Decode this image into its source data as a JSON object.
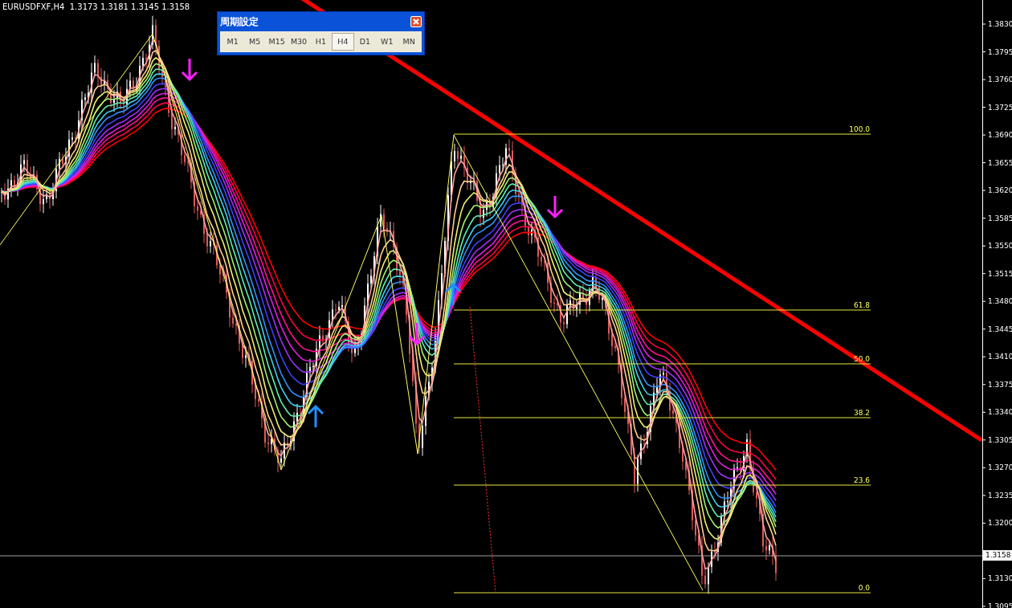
{
  "chart_header": "EURUSDFXF,H4  1.3173 1.3181 1.3145 1.3158",
  "period_dialog": {
    "title": "周期設定",
    "periods": [
      {
        "label": "M1",
        "selected": false
      },
      {
        "label": "M5",
        "selected": false
      },
      {
        "label": "M15",
        "selected": false
      },
      {
        "label": "M30",
        "selected": false
      },
      {
        "label": "H1",
        "selected": false
      },
      {
        "label": "H4",
        "selected": true
      },
      {
        "label": "D1",
        "selected": false
      },
      {
        "label": "W1",
        "selected": false
      },
      {
        "label": "MN",
        "selected": false
      }
    ]
  },
  "price_axis": [
    "1.3830",
    "1.3795",
    "1.3760",
    "1.3725",
    "1.3690",
    "1.3655",
    "1.3620",
    "1.3585",
    "1.3550",
    "1.3515",
    "1.3480",
    "1.3445",
    "1.3410",
    "1.3375",
    "1.3340",
    "1.3305",
    "1.3270",
    "1.3235",
    "1.3200",
    "1.3130",
    "1.3095"
  ],
  "current_price": "1.3158",
  "fibonacci_levels": [
    "100.0",
    "61.8",
    "50.0",
    "38.2",
    "23.6",
    "0.0"
  ],
  "signals": [
    {
      "kind": "down"
    },
    {
      "kind": "up"
    },
    {
      "kind": "down"
    },
    {
      "kind": "up"
    },
    {
      "kind": "down"
    }
  ]
}
